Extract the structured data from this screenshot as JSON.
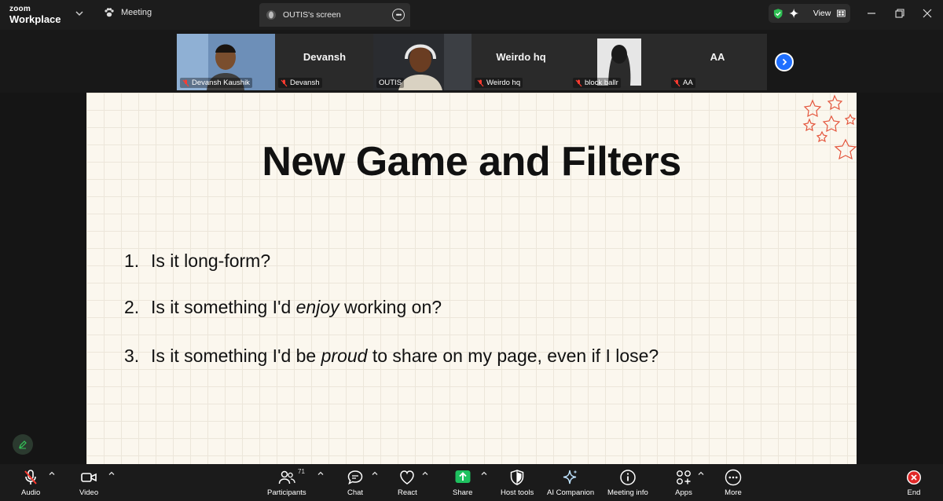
{
  "app": {
    "logo_top": "zoom",
    "logo_bottom": "Workplace"
  },
  "tabs": {
    "meeting": "Meeting",
    "screen": "OUTIS's screen"
  },
  "view_label": "View",
  "gallery": [
    {
      "display": "",
      "label": "Devansh Kaushik",
      "muted": true,
      "video": true,
      "active": false
    },
    {
      "display": "Devansh",
      "label": "Devansh",
      "muted": true,
      "video": false,
      "active": false
    },
    {
      "display": "",
      "label": "OUTIS",
      "muted": false,
      "video": true,
      "active": true
    },
    {
      "display": "Weirdo hq",
      "label": "Weirdo hq",
      "muted": true,
      "video": false,
      "active": false
    },
    {
      "display": "",
      "label": "block ballr",
      "muted": true,
      "video": true,
      "active": false
    },
    {
      "display": "AA",
      "label": "AA",
      "muted": true,
      "video": false,
      "active": false
    }
  ],
  "slide": {
    "title": "New Game and Filters",
    "items": [
      {
        "num": "1.",
        "pre": "Is it long-form?",
        "em": "",
        "post": ""
      },
      {
        "num": "2.",
        "pre": "Is it something I'd ",
        "em": "enjoy",
        "post": " working on?"
      },
      {
        "num": "3.",
        "pre": "Is it something I'd be ",
        "em": "proud",
        "post": " to share on my page, even if I lose?"
      }
    ]
  },
  "toolbar": {
    "audio": "Audio",
    "video": "Video",
    "participants": "Participants",
    "participants_count": "71",
    "chat": "Chat",
    "react": "React",
    "share": "Share",
    "host_tools": "Host tools",
    "ai_companion": "AI Companion",
    "meeting_info": "Meeting info",
    "apps": "Apps",
    "more": "More",
    "end": "End"
  },
  "colors": {
    "accent_green": "#34c759",
    "share_green": "#1ec15f",
    "end_red": "#e02828",
    "blue": "#1f6fff"
  }
}
